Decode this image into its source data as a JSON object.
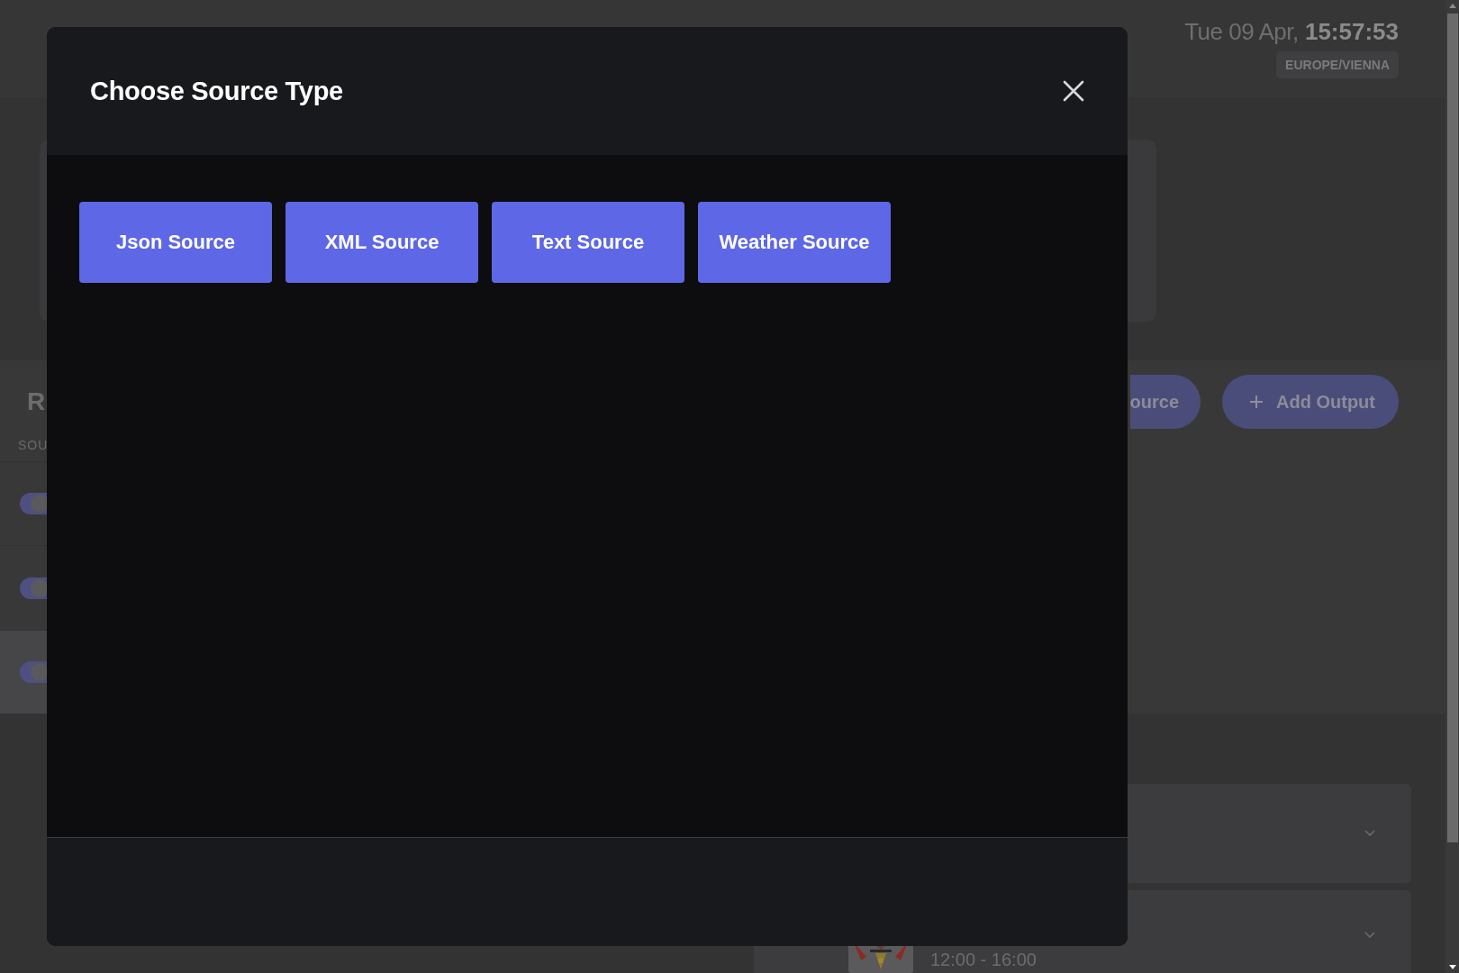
{
  "header": {
    "date": "Tue 09 Apr,",
    "time": "15:57:53",
    "timezone": "EUROPE/VIENNA"
  },
  "sources_panel": {
    "heading": "R",
    "column_label": "SOU",
    "rows": [
      {
        "on": true,
        "selected": false
      },
      {
        "on": true,
        "selected": false
      },
      {
        "on": true,
        "selected": true
      }
    ]
  },
  "actions": [
    {
      "label": "ource",
      "plus_icon": false
    },
    {
      "label": "Add Output",
      "plus_icon": true
    }
  ],
  "schedule": {
    "cards": [
      {
        "expanded": false
      },
      {
        "expanded": false,
        "time": "12:00 - 16:00"
      }
    ]
  },
  "modal": {
    "title": "Choose Source Type",
    "source_types": [
      "Json Source",
      "XML Source",
      "Text Source",
      "Weather Source"
    ]
  }
}
